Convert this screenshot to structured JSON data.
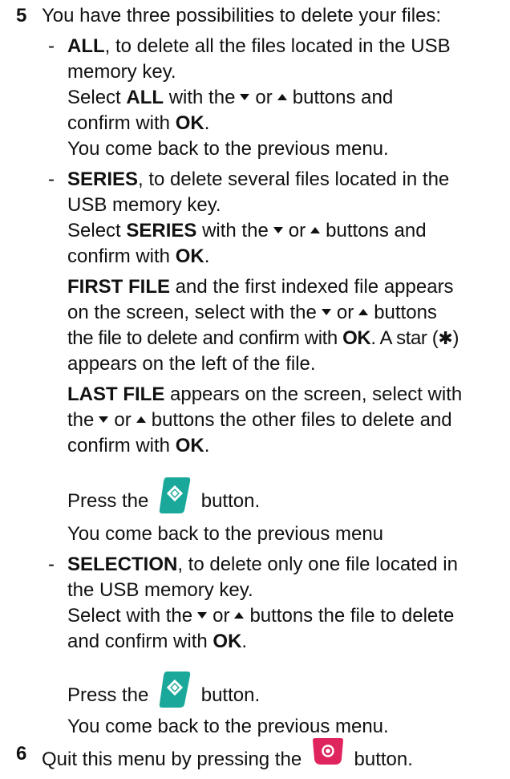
{
  "step5": {
    "number": "5",
    "intro": "You have three possibilities to delete your files:",
    "bullet": "-",
    "all": {
      "kw": "ALL",
      "desc": ", to delete all the files located in the USB",
      "desc2": "memory key.",
      "select_pre": "Select ",
      "select_kw": "ALL",
      "select_post": " with the",
      "or": "or",
      "buttons_and": "buttons and",
      "confirm": "confirm with ",
      "ok": "OK",
      "dot": ".",
      "back": "You come back to the previous menu."
    },
    "series": {
      "kw": "SERIES",
      "desc": ", to delete several files located in the",
      "desc2": "USB memory key.",
      "select_pre": "Select ",
      "select_kw": "SERIES",
      "select_post": " with the",
      "or": "or",
      "buttons_and": "buttons and",
      "confirm": "confirm with ",
      "ok": "OK",
      "dot": ".",
      "first_kw": "FIRST FILE",
      "first_rest": " and the first indexed file appears",
      "screen_select": "on the screen, select with the",
      "buttons": "buttons",
      "file_delete": "the file to delete and confirm with ",
      "star_sentence": ". A star (",
      "star_symbol": "✱",
      "star_close": ")",
      "appears_left": "appears on the left of the file.",
      "last_kw": "LAST FILE",
      "last_rest": " appears on the screen, select with",
      "the": "the",
      "other_files": "buttons the other files to delete and",
      "confirm2": "confirm with ",
      "press": "Press the",
      "button_word": "button.",
      "back": "You come back to the previous menu"
    },
    "selection": {
      "kw": "SELECTION",
      "desc": ", to delete only one file located in",
      "desc2": "the USB memory key.",
      "select_pre": "Select with the",
      "or": "or",
      "buttons_file": "buttons the file to delete",
      "and_confirm": "and confirm with ",
      "ok": "OK",
      "dot": ".",
      "press": "Press the",
      "button_word": "button.",
      "back": "You come back to the previous menu."
    }
  },
  "step6": {
    "number": "6",
    "text": "Quit this menu by pressing the",
    "button_word": "button."
  },
  "icons": {
    "start_color": "#1aa89a",
    "stop_color": "#e0245e"
  }
}
